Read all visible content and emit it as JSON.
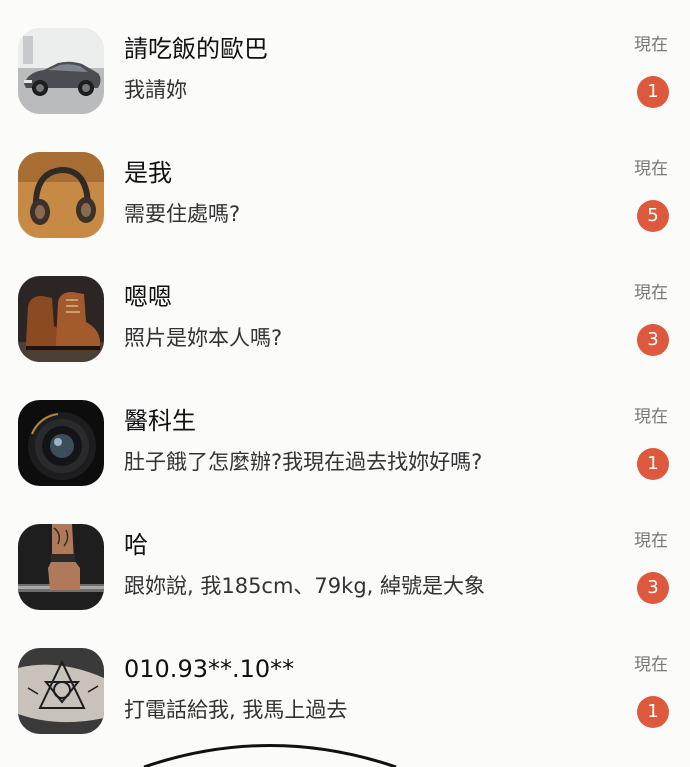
{
  "chats": [
    {
      "name": "請吃飯的歐巴",
      "preview": "我請妳",
      "time": "現在",
      "unread": "1",
      "avatar_icon": "car-icon"
    },
    {
      "name": "是我",
      "preview": "需要住處嗎?",
      "time": "現在",
      "unread": "5",
      "avatar_icon": "headphones-icon"
    },
    {
      "name": "嗯嗯",
      "preview": "照片是妳本人嗎?",
      "time": "現在",
      "unread": "3",
      "avatar_icon": "boots-icon"
    },
    {
      "name": "醫科生",
      "preview": "肚子餓了怎麼辦?我現在過去找妳好嗎?",
      "time": "現在",
      "unread": "1",
      "avatar_icon": "camera-lens-icon"
    },
    {
      "name": "哈",
      "preview": "跟妳說, 我185cm、79kg, 綽號是大象",
      "time": "現在",
      "unread": "3",
      "avatar_icon": "barbell-hand-icon"
    },
    {
      "name": "010.93**.10**",
      "preview": "打電話給我, 我馬上過去",
      "time": "現在",
      "unread": "1",
      "avatar_icon": "tattoo-arm-icon"
    }
  ],
  "colors": {
    "badge": "#dd593e",
    "background": "#fbfbfa"
  }
}
